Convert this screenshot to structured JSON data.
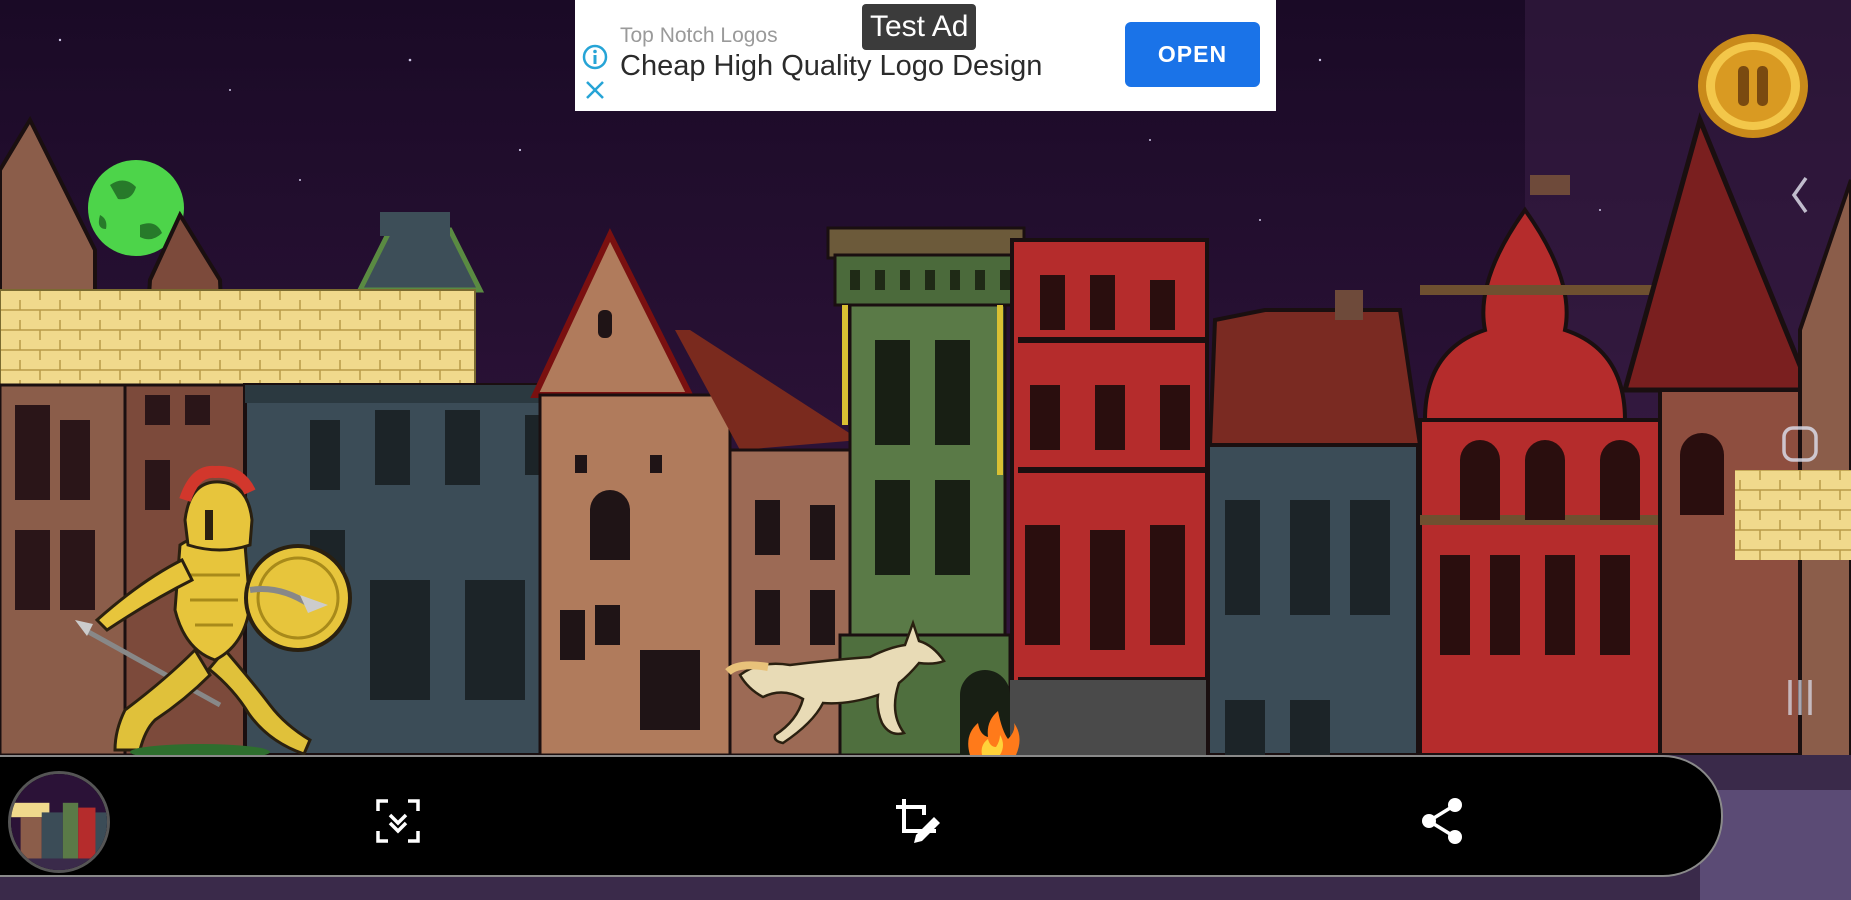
{
  "ad": {
    "brand": "Top Notch Logos",
    "headline": "Cheap High Quality Logo Design",
    "open_label": "OPEN",
    "test_label": "Test Ad",
    "accent_color": "#1a73e8"
  },
  "game": {
    "pause_icon": "pause-icon",
    "player": "spartan-warrior",
    "enemy": "running-dog"
  },
  "screenshot_toolbar": {
    "buttons": [
      {
        "name": "scroll-capture-button",
        "icon": "scroll-capture-icon"
      },
      {
        "name": "edit-button",
        "icon": "crop-edit-icon"
      },
      {
        "name": "share-button",
        "icon": "share-icon"
      }
    ]
  },
  "system_nav": {
    "buttons": [
      "back-icon",
      "home-icon",
      "recents-icon"
    ]
  }
}
